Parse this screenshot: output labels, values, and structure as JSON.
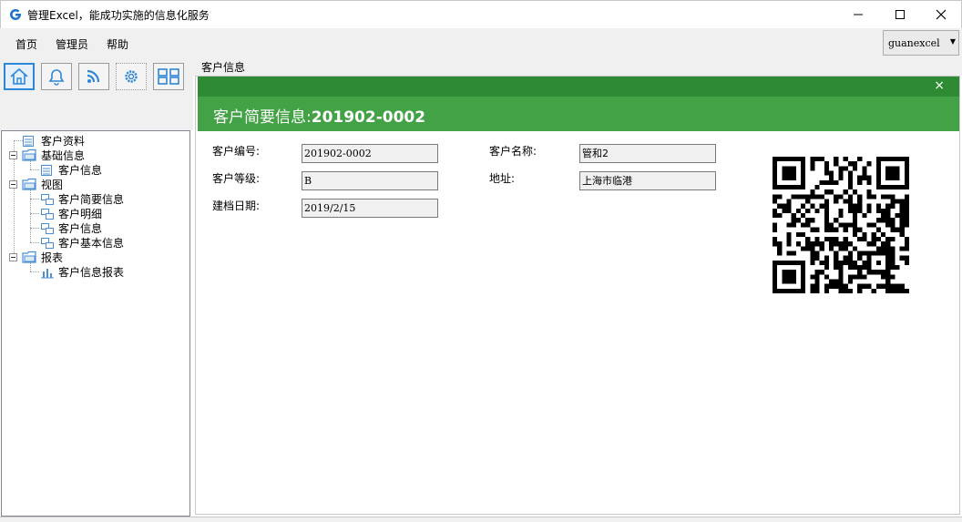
{
  "window": {
    "title": "管理Excel，能成功实施的信息化服务",
    "controls": {
      "minimize": "—",
      "maximize": "☐",
      "close": "✕"
    }
  },
  "menu": {
    "items": [
      "首页",
      "管理员",
      "帮助"
    ]
  },
  "user": {
    "selected": "guanexcel"
  },
  "toolbar": {
    "buttons": [
      "home-icon",
      "bell-icon",
      "rss-icon",
      "settings-icon",
      "grid-icon"
    ],
    "accent": "#2f86d6"
  },
  "tree": {
    "nodes": [
      {
        "label": "客户资料",
        "type": "table"
      },
      {
        "label": "基础信息",
        "type": "folder",
        "expanded": true
      },
      {
        "label": "客户信息",
        "type": "table"
      },
      {
        "label": "视图",
        "type": "folder",
        "expanded": true
      },
      {
        "label": "客户简要信息",
        "type": "view"
      },
      {
        "label": "客户明细",
        "type": "view"
      },
      {
        "label": "客户信息",
        "type": "view"
      },
      {
        "label": "客户基本信息",
        "type": "view"
      },
      {
        "label": "报表",
        "type": "folder",
        "expanded": true
      },
      {
        "label": "客户信息报表",
        "type": "report"
      }
    ]
  },
  "tab": {
    "label": "客户信息"
  },
  "panel": {
    "title_prefix": "客户简要信息:",
    "title_id": "201902-0002",
    "close": "×",
    "header_color": "#42a245",
    "header_dark": "#2e8b33"
  },
  "form": {
    "customer_no_label": "客户编号:",
    "customer_no": "201902-0002",
    "customer_name_label": "客户名称:",
    "customer_name": "管和2",
    "level_label": "客户等级:",
    "level": "B",
    "address_label": "地址:",
    "address": "上海市临港",
    "created_label": "建档日期:",
    "created": "2019/2/15"
  }
}
